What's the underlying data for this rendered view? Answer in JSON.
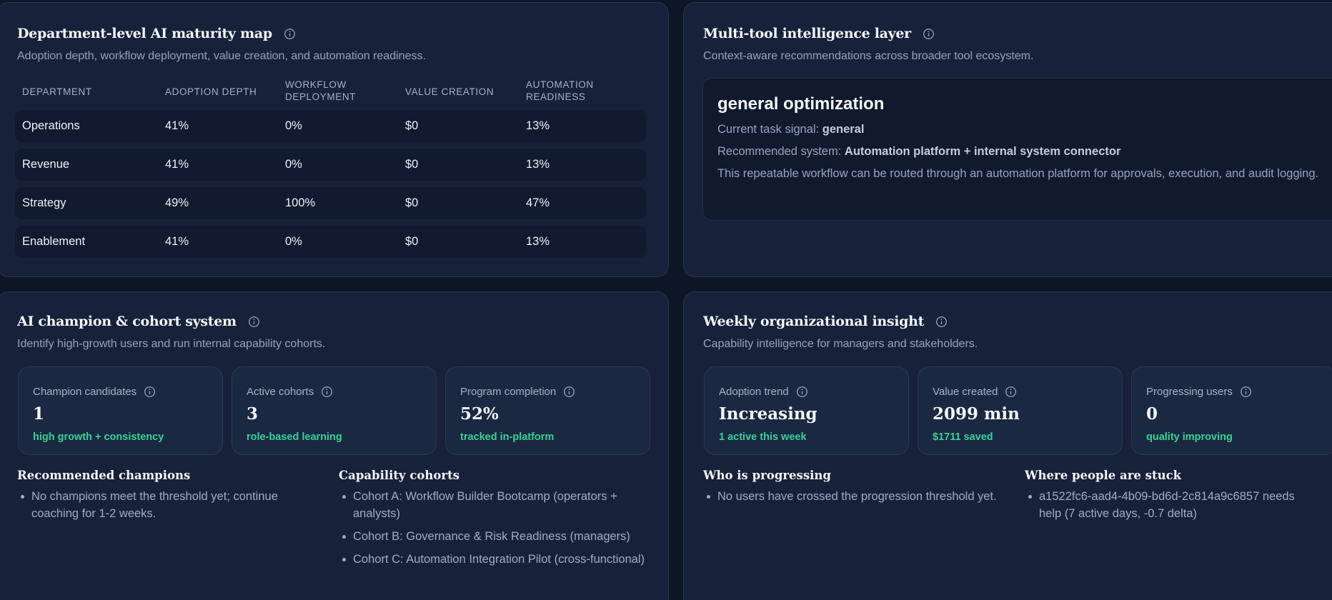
{
  "maturity": {
    "title": "Department-level AI maturity map",
    "subtitle": "Adoption depth, workflow deployment, value creation, and automation readiness.",
    "columns": [
      "DEPARTMENT",
      "ADOPTION DEPTH",
      "WORKFLOW DEPLOYMENT",
      "VALUE CREATION",
      "AUTOMATION READINESS"
    ],
    "rows": [
      {
        "department": "Operations",
        "adoption": "41%",
        "workflow": "0%",
        "value": "$0",
        "automation": "13%"
      },
      {
        "department": "Revenue",
        "adoption": "41%",
        "workflow": "0%",
        "value": "$0",
        "automation": "13%"
      },
      {
        "department": "Strategy",
        "adoption": "49%",
        "workflow": "100%",
        "value": "$0",
        "automation": "47%"
      },
      {
        "department": "Enablement",
        "adoption": "41%",
        "workflow": "0%",
        "value": "$0",
        "automation": "13%"
      }
    ]
  },
  "multitool": {
    "title": "Multi-tool intelligence layer",
    "subtitle": "Context-aware recommendations across broader tool ecosystem.",
    "card_title": "general optimization",
    "signal_label": "Current task signal:",
    "signal_value": "general",
    "system_label": "Recommended system:",
    "system_value": "Automation platform + internal system connector",
    "description": "This repeatable workflow can be routed through an automation platform for approvals, execution, and audit logging."
  },
  "champion": {
    "title": "AI champion & cohort system",
    "subtitle": "Identify high-growth users and run internal capability cohorts.",
    "stats": [
      {
        "label": "Champion candidates",
        "value": "1",
        "note": "high growth + consistency"
      },
      {
        "label": "Active cohorts",
        "value": "3",
        "note": "role-based learning"
      },
      {
        "label": "Program completion",
        "value": "52%",
        "note": "tracked in-platform"
      }
    ],
    "recommended_title": "Recommended champions",
    "recommended_items": [
      "No champions meet the threshold yet; continue coaching for 1-2 weeks."
    ],
    "cohorts_title": "Capability cohorts",
    "cohorts_items": [
      "Cohort A: Workflow Builder Bootcamp (operators + analysts)",
      "Cohort B: Governance & Risk Readiness (managers)",
      "Cohort C: Automation Integration Pilot (cross-functional)"
    ]
  },
  "weekly": {
    "title": "Weekly organizational insight",
    "subtitle": "Capability intelligence for managers and stakeholders.",
    "stats": [
      {
        "label": "Adoption trend",
        "value": "Increasing",
        "note": "1 active this week"
      },
      {
        "label": "Value created",
        "value": "2099 min",
        "note": "$1711 saved"
      },
      {
        "label": "Progressing users",
        "value": "0",
        "note": "quality improving"
      }
    ],
    "progressing_title": "Who is progressing",
    "progressing_items": [
      "No users have crossed the progression threshold yet."
    ],
    "stuck_title": "Where people are stuck",
    "stuck_items": [
      "a1522fc6-aad4-4b09-bd6d-2c814a9c6857 needs help (7 active days, -0.7 delta)"
    ]
  },
  "colors": {
    "background": "#0d1527",
    "panel": "#172139",
    "accent_green": "#34d399"
  },
  "icons": {
    "info": "info-icon"
  }
}
